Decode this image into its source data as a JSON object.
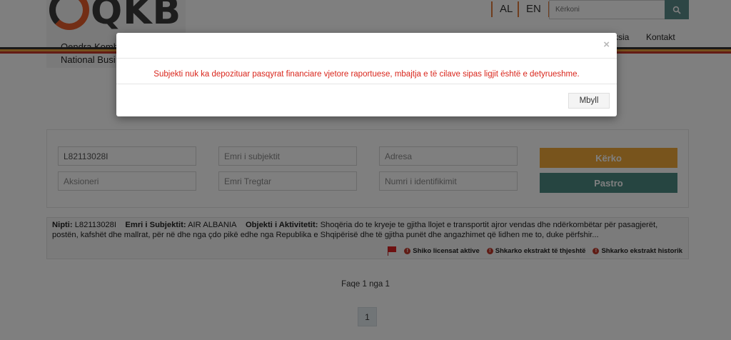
{
  "header": {
    "logo_text": "QKB",
    "logo_line1": "Qendra Kombe",
    "logo_line2": "National Busi",
    "languages": [
      "AL",
      "EN"
    ],
    "search_placeholder": "Kërkoni",
    "nav": [
      "ksia",
      "Kontakt"
    ],
    "stripe_colors": [
      "#333333",
      "#e8a03a",
      "#c9392b"
    ]
  },
  "form": {
    "nipt_value": "L82113028I",
    "placeholders": {
      "emri_subjektit": "Emri i subjektit",
      "adresa": "Adresa",
      "aksioneri": "Aksioneri",
      "emri_tregtar": "Emri Tregtar",
      "numri_identifikimit": "Numri i identifikimit"
    },
    "search_button": "Kërko",
    "clear_button": "Pastro",
    "colors": {
      "search": "#f0a838",
      "clear": "#4c8b83"
    }
  },
  "result": {
    "nipt_label": "Nipti:",
    "nipt_value": "L82113028I",
    "name_label": "Emri i Subjektit:",
    "name_value": "AIR ALBANIA",
    "activity_label": "Objekti i Aktivitetit:",
    "activity_value": "Shoqëria do te kryeje te gjitha llojet e transportit ajror vendas dhe ndërkombëtar për pasagjerët, postën, kafshët dhe mallrat, për në dhe nga çdo pikë edhe nga Republika e Shqipërisë dhe të gjitha punët dhe angazhimet që lidhen me to, duke përfshir...",
    "actions": [
      "Shiko licensat aktive",
      "Shkarko ekstrakt të thjeshtë",
      "Shkarko ekstrakt historik"
    ]
  },
  "pagination": {
    "text": "Faqe 1 nga 1",
    "current_page": "1"
  },
  "modal": {
    "close_symbol": "×",
    "message": "Subjekti nuk ka depozituar pasqyrat financiare vjetore raportuese, mbajtja e të cilave sipas ligjit është e detyrueshme.",
    "close_button": "Mbyll",
    "message_color": "#d9261c"
  }
}
